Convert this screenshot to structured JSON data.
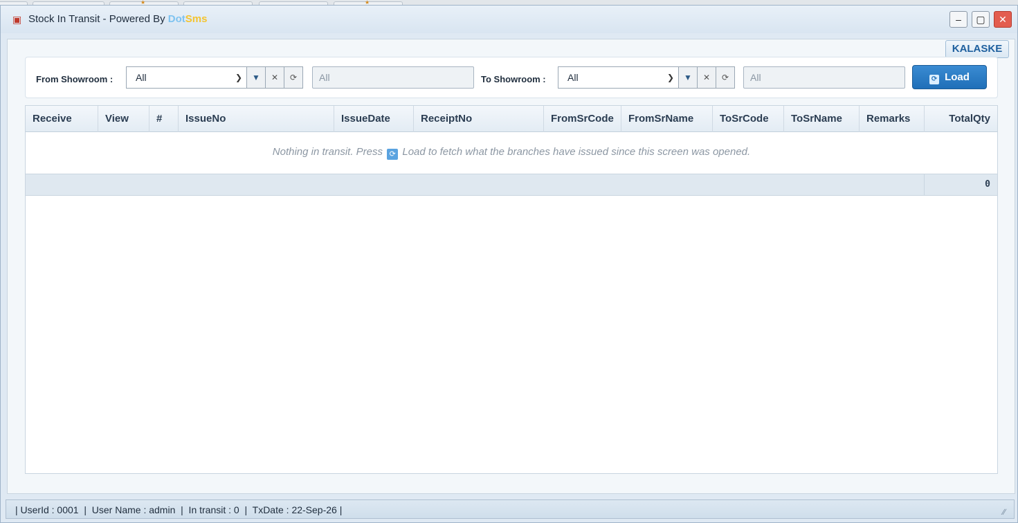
{
  "window": {
    "title_prefix": "Stock In Transit - Powered By ",
    "brand_part1": "Dot",
    "brand_part2": "Sms",
    "icon": "truck-icon",
    "minimize_glyph": "–",
    "maximize_glyph": "▢",
    "close_glyph": "✕"
  },
  "company_badge": "KALASKE",
  "filters": {
    "from_label": "From Showroom :",
    "from_value": "All",
    "from_search_placeholder": "All",
    "to_label": "To Showroom :",
    "to_value": "All",
    "to_search_placeholder": "All"
  },
  "load_button": {
    "label": "Load",
    "icon": "refresh-icon"
  },
  "grid": {
    "columns": [
      "Receive",
      "View",
      "#",
      "IssueNo",
      "IssueDate",
      "ReceiptNo",
      "FromSrCode",
      "FromSrName",
      "ToSrCode",
      "ToSrName",
      "Remarks",
      "TotalQty"
    ],
    "empty_message_before": "Nothing in transit. Press",
    "empty_message_after": "Load to fetch what the branches have issued since this screen was opened.",
    "footer_total_qty": "0"
  },
  "status_bar": {
    "text": "| UserId : 0001  |  User Name : admin  |  In transit : 0  |  TxDate : 22-Sep-26 |"
  },
  "colors": {
    "accent": "#1f6fb8",
    "brand_dot": "#7ec3f0",
    "brand_sms": "#f4c430",
    "close_button": "#e35d4f"
  }
}
